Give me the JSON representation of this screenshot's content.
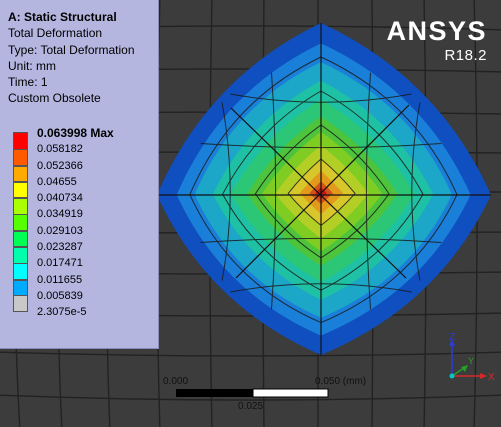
{
  "legend": {
    "analysis_title": "A: Static Structural",
    "result_name": "Total Deformation",
    "result_type": "Type: Total Deformation",
    "unit": "Unit: mm",
    "time": "Time: 1",
    "custom_note": "Custom Obsolete",
    "scale": [
      {
        "label": "0.063998 Max",
        "color": "#ff0000"
      },
      {
        "label": "0.058182",
        "color": "#ff5a00"
      },
      {
        "label": "0.052366",
        "color": "#ffaa00"
      },
      {
        "label": "0.04655",
        "color": "#ffff00"
      },
      {
        "label": "0.040734",
        "color": "#aaff00"
      },
      {
        "label": "0.034919",
        "color": "#55ff00"
      },
      {
        "label": "0.029103",
        "color": "#00ff55"
      },
      {
        "label": "0.023287",
        "color": "#00ffaa"
      },
      {
        "label": "0.017471",
        "color": "#00ffff"
      },
      {
        "label": "0.011655",
        "color": "#00aaff"
      },
      {
        "label": "0.005839",
        "color": "#0055ff"
      },
      {
        "label": "2.3075e-5",
        "color": "#c8c8c8"
      }
    ]
  },
  "brand": {
    "name": "ANSYS",
    "version": "R18.2"
  },
  "scale_bar": {
    "start": "0.000",
    "end": "0.050 (mm)",
    "mid": "0.025"
  },
  "triad": {
    "x_label": "X",
    "y_label": "Y",
    "z_label": "Z"
  },
  "colors": {
    "background": "#3c3c3c",
    "mesh_lines": "#222222",
    "legend_bg": "#b4b6df"
  }
}
